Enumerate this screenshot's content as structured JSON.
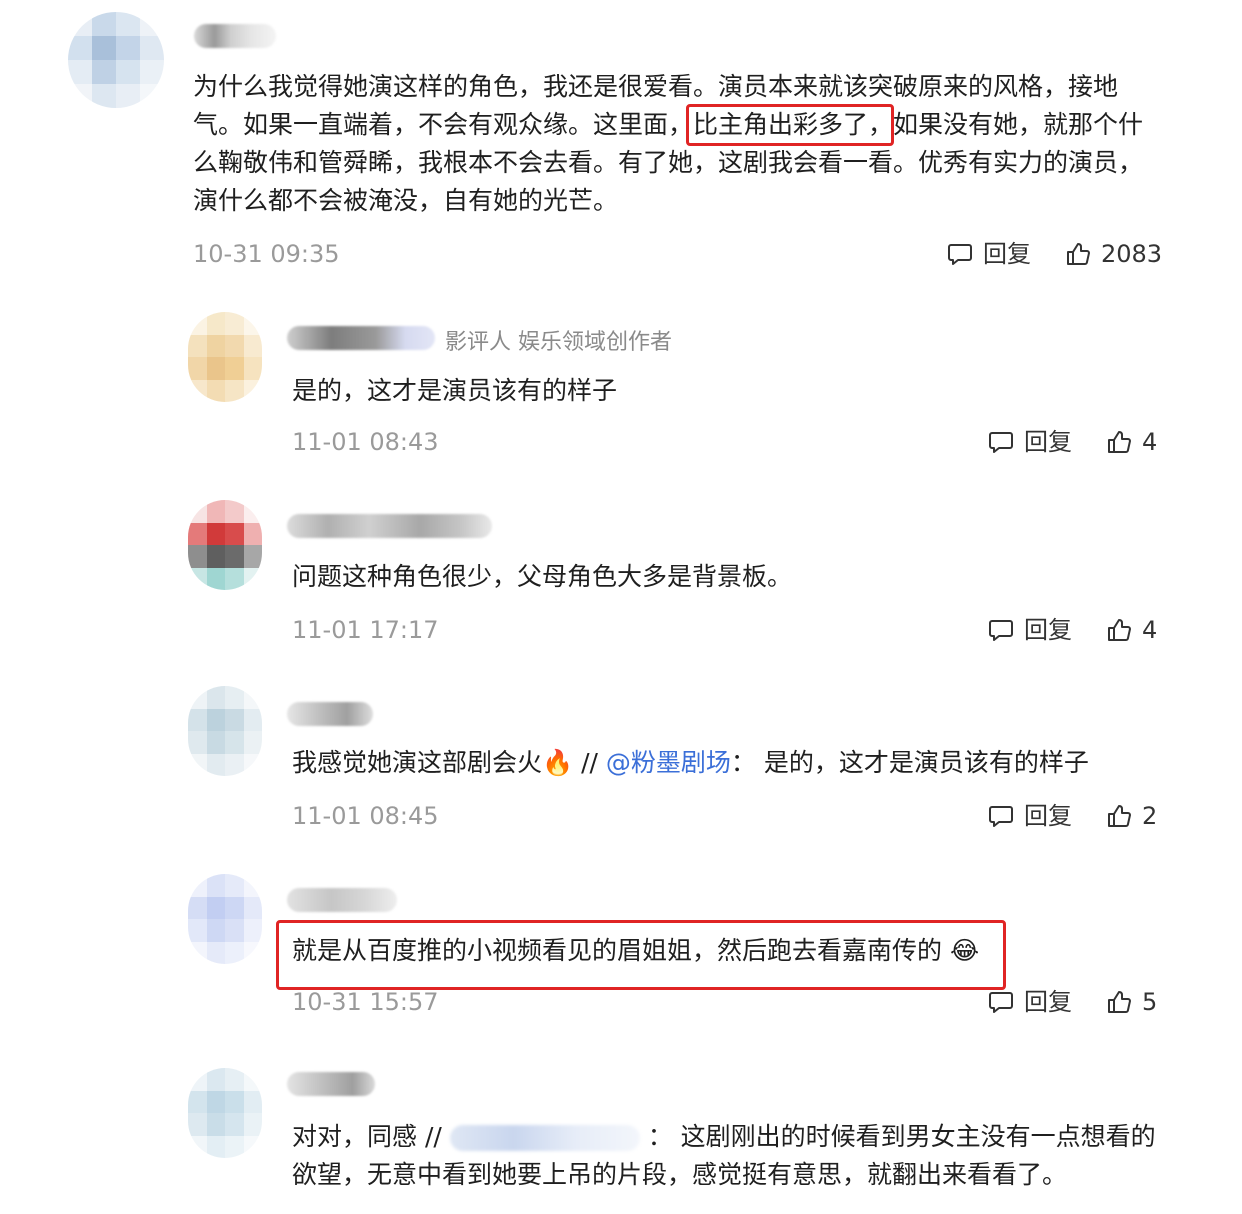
{
  "comments": [
    {
      "text": "为什么我觉得她演这样的角色，我还是很爱看。演员本来就该突破原来的风格，接地气。如果一直端着，不会有观众缘。这里面，比主角出彩多了，如果没有她，就那个什么鞠敬伟和管舜睎，我根本不会去看。有了她，这剧我会看一看。优秀有实力的演员，演什么都不会被淹没，自有她的光芒。",
      "time": "10-31 09:35",
      "reply_label": "回复",
      "likes": "2083"
    },
    {
      "tag": "影评人 娱乐领域创作者",
      "text": "是的，这才是演员该有的样子",
      "time": "11-01 08:43",
      "reply_label": "回复",
      "likes": "4"
    },
    {
      "text": "问题这种角色很少，父母角色大多是背景板。",
      "time": "11-01 17:17",
      "reply_label": "回复",
      "likes": "4"
    },
    {
      "text_before": "我感觉她演这部剧会火🔥 // ",
      "mention": "@粉墨剧场",
      "text_after": "： 是的，这才是演员该有的样子",
      "time": "11-01 08:45",
      "reply_label": "回复",
      "likes": "2"
    },
    {
      "text": "就是从百度推的小视频看见的眉姐姐，然后跑去看嘉南传的 😂",
      "time": "10-31 15:57",
      "reply_label": "回复",
      "likes": "5"
    },
    {
      "text_before": "对对，同感 //",
      "text_after": "： 这剧刚出的时候看到男女主没有一点想看的欲望，无意中看到她要上吊的片段，感觉挺有意思，就翻出来看看了。"
    }
  ],
  "colors": {
    "highlight": "#e02424",
    "mention": "#3b6fd8",
    "time": "#9a9a9a"
  },
  "icons": [
    "comment-icon",
    "thumbs-up-icon"
  ]
}
